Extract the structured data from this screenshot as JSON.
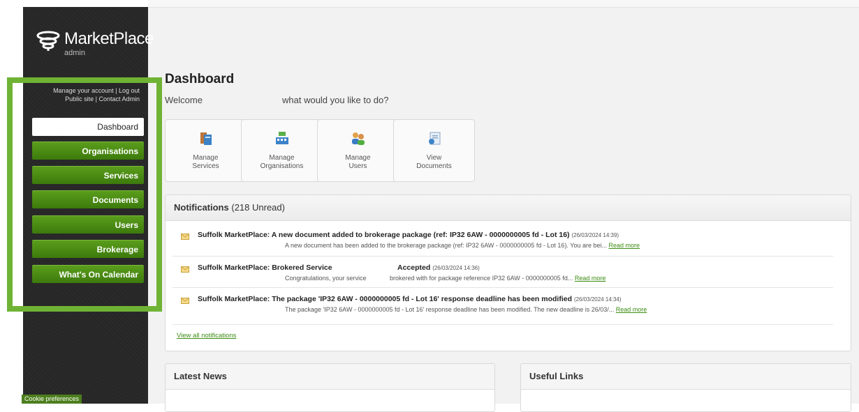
{
  "app": {
    "logo_text": "MarketPlace",
    "logo_subtitle": "admin"
  },
  "account": {
    "manage": "Manage your account",
    "sep1": " | ",
    "logout": "Log out",
    "public_site": "Public site",
    "sep2": " | ",
    "contact": "Contact Admin"
  },
  "sidebar": {
    "items": [
      {
        "label": "Dashboard"
      },
      {
        "label": "Organisations"
      },
      {
        "label": "Services"
      },
      {
        "label": "Documents"
      },
      {
        "label": "Users"
      },
      {
        "label": "Brokerage"
      },
      {
        "label": "What's On Calendar"
      }
    ],
    "cookie": "Cookie preferences"
  },
  "main": {
    "title": "Dashboard",
    "welcome": "Welcome",
    "question": "what would you like to do?",
    "tiles": [
      {
        "line1": "Manage",
        "line2": "Services",
        "icon": "manage-services-icon"
      },
      {
        "line1": "Manage",
        "line2": "Organisations",
        "icon": "manage-organisations-icon"
      },
      {
        "line1": "Manage",
        "line2": "Users",
        "icon": "manage-users-icon"
      },
      {
        "line1": "View",
        "line2": "Documents",
        "icon": "view-documents-icon"
      }
    ]
  },
  "notifications": {
    "heading": "Notifications",
    "unread": "(218 Unread)",
    "items": [
      {
        "title": "Suffolk MarketPlace: A new document added to brokerage package (ref: IP32 6AW - 0000000005 fd - Lot 16)",
        "time": "(26/03/2024 14:39)",
        "body": "A new document has been added to the brokerage package (ref: IP32 6AW - 0000000005 fd - Lot 16). You are bei...",
        "read_more": "Read more"
      },
      {
        "title": "Suffolk MarketPlace: Brokered Service",
        "title2": "Accepted",
        "time": "(26/03/2024 14:36)",
        "body": "Congratulations, your service",
        "body2": "brokered with for package reference IP32 6AW - 0000000005 fd...",
        "read_more": "Read more"
      },
      {
        "title": "Suffolk MarketPlace: The package 'IP32 6AW - 0000000005 fd - Lot 16' response deadline has been modified",
        "time": "(26/03/2024 14:34)",
        "body": "The package 'IP32 6AW - 0000000005 fd - Lot 16' response deadline has been modified. The new deadline is 26/03/...",
        "read_more": "Read more"
      }
    ],
    "view_all": "View all notifications"
  },
  "latest_news": {
    "heading": "Latest News"
  },
  "useful_links": {
    "heading": "Useful Links"
  },
  "colors": {
    "accent_green": "#6fb335",
    "nav_green": "#4a8a14",
    "link_green": "#3b8c12"
  }
}
